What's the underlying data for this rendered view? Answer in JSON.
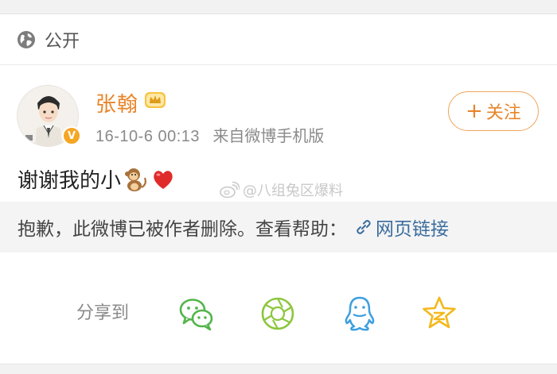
{
  "visibility": {
    "label": "公开",
    "icon": "globe-icon"
  },
  "post": {
    "username": "张翰",
    "badge_icon": "crown-icon",
    "time": "16-10-6 00:13",
    "source": "来自微博手机版",
    "follow_label": "关注",
    "follow_prefix": "+",
    "text": "谢谢我的小",
    "emoji": [
      "monkey-icon",
      "heart-icon"
    ]
  },
  "watermark": {
    "text": "@八组兔区爆料"
  },
  "deleted_notice": {
    "text": "抱歉，此微博已被作者删除。查看帮助：",
    "link_label": "网页链接"
  },
  "share": {
    "label": "分享到",
    "targets": [
      "wechat-icon",
      "moments-icon",
      "qq-icon",
      "qzone-icon"
    ]
  },
  "colors": {
    "accent": "#e8852a",
    "link": "#3a6c9e",
    "wechat": "#52b54a",
    "moments": "#8cc63e",
    "qq": "#3d9fe0",
    "qzone": "#f3b81b"
  }
}
